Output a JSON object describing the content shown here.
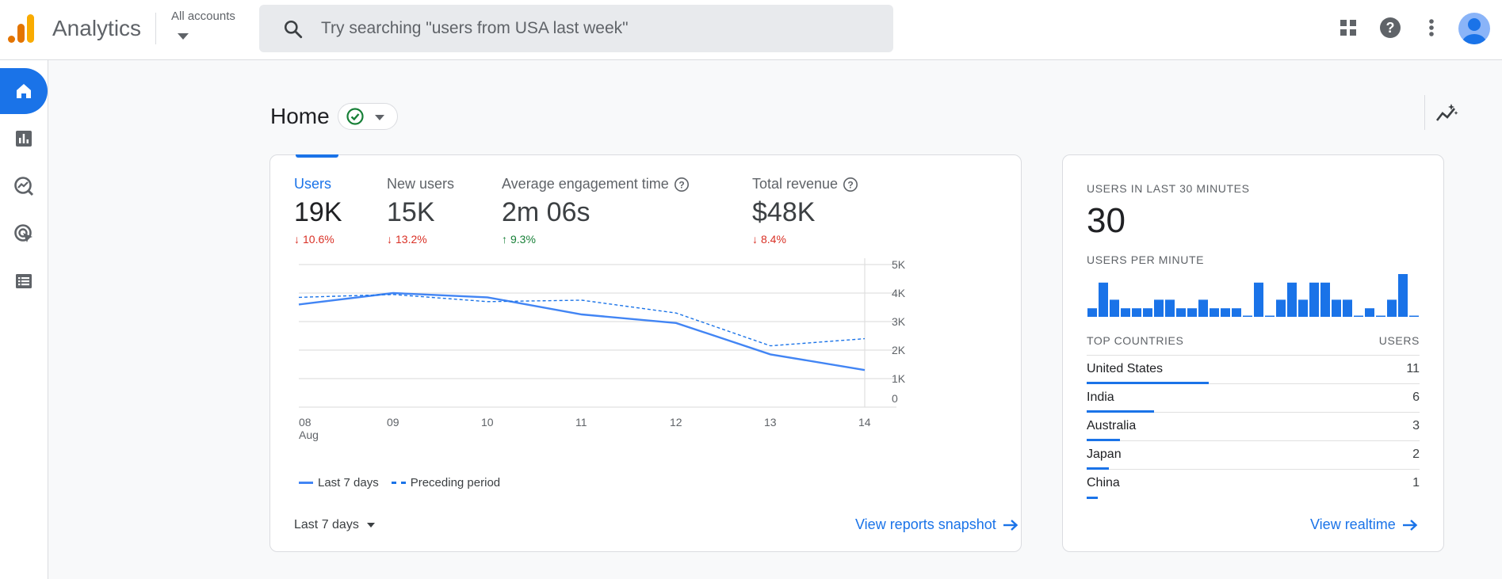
{
  "header": {
    "app_title": "Analytics",
    "accounts_label": "All accounts",
    "search_placeholder": "Try searching \"users from USA last week\""
  },
  "page": {
    "title": "Home"
  },
  "metrics": [
    {
      "label": "Users",
      "value": "19K",
      "delta": "10.6%",
      "direction": "down"
    },
    {
      "label": "New users",
      "value": "15K",
      "delta": "13.2%",
      "direction": "down"
    },
    {
      "label": "Average engagement time",
      "value": "2m 06s",
      "delta": "9.3%",
      "direction": "up"
    },
    {
      "label": "Total revenue",
      "value": "$48K",
      "delta": "8.4%",
      "direction": "down"
    }
  ],
  "chart_data": {
    "type": "line",
    "x": [
      "08",
      "09",
      "10",
      "11",
      "12",
      "13",
      "14"
    ],
    "x_sublabel_first": "Aug",
    "y_ticks": [
      "0",
      "1K",
      "2K",
      "3K",
      "4K",
      "5K"
    ],
    "ylim": [
      0,
      5000
    ],
    "y_axis_position": "right",
    "series": [
      {
        "name": "Last 7 days",
        "style": "solid",
        "values": [
          3600,
          4000,
          3850,
          3250,
          2950,
          1850,
          1300
        ]
      },
      {
        "name": "Preceding period",
        "style": "dashed",
        "values": [
          3850,
          3950,
          3700,
          3750,
          3300,
          2150,
          2400
        ]
      }
    ]
  },
  "footer": {
    "date_range": "Last 7 days",
    "view_snapshot": "View reports snapshot",
    "view_realtime": "View realtime"
  },
  "realtime": {
    "users_label": "USERS IN LAST 30 MINUTES",
    "users_value": "30",
    "per_minute_label": "USERS PER MINUTE",
    "per_minute": [
      1,
      4,
      2,
      1,
      1,
      1,
      2,
      2,
      1,
      1,
      2,
      1,
      1,
      1,
      0,
      4,
      0,
      2,
      4,
      2,
      4,
      4,
      2,
      2,
      0,
      1,
      0,
      2,
      5,
      0
    ],
    "countries_label": "TOP COUNTRIES",
    "users_col_label": "USERS",
    "countries": [
      {
        "name": "United States",
        "users": "11",
        "share": 1.0
      },
      {
        "name": "India",
        "users": "6",
        "share": 0.55
      },
      {
        "name": "Australia",
        "users": "3",
        "share": 0.27
      },
      {
        "name": "Japan",
        "users": "2",
        "share": 0.18
      },
      {
        "name": "China",
        "users": "1",
        "share": 0.09
      }
    ]
  }
}
